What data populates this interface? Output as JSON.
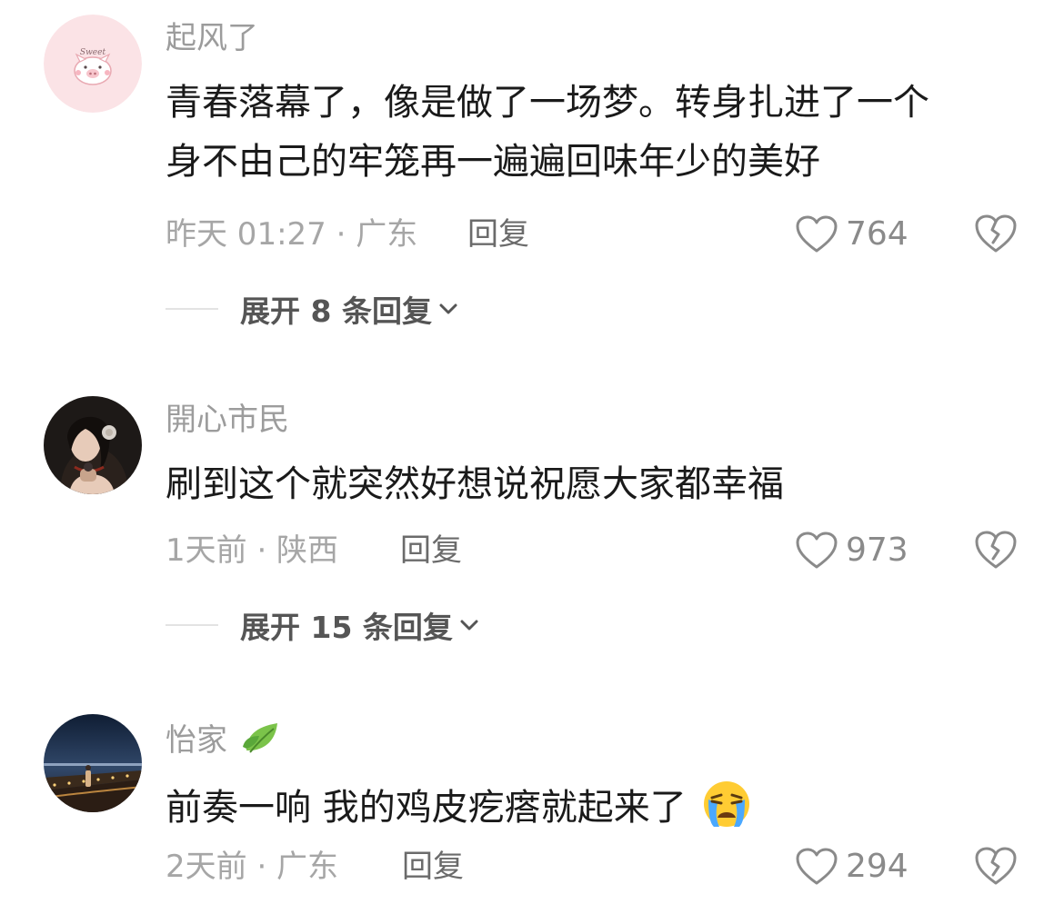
{
  "comments": [
    {
      "username": "起风了",
      "avatar_icon": "pig-sweet-avatar",
      "text_lines": [
        "青春落幕了，像是做了一场梦。转身扎进了一个",
        "身不由己的牢笼再一遍遍回味年少的美好"
      ],
      "meta": "昨天 01:27 · 广东",
      "reply_label": "回复",
      "likes": "764",
      "expand_label": "展开 8 条回复"
    },
    {
      "username": "開心市民",
      "avatar_icon": "woman-portrait-avatar",
      "text_lines": [
        "刷到这个就突然好想说祝愿大家都幸福"
      ],
      "meta": "1天前 · 陕西",
      "reply_label": "回复",
      "likes": "973",
      "expand_label": "展开 15 条回复"
    },
    {
      "username": "怡家",
      "username_badge_icon": "leaf-icon",
      "avatar_icon": "night-bridge-avatar",
      "text_lines": [
        "前奏一响 我的鸡皮疙瘩就起来了"
      ],
      "text_emoji_icon": "crying-face-emoji",
      "meta": "2天前 · 广东",
      "reply_label": "回复",
      "likes": "294"
    }
  ],
  "colors": {
    "username": "#9c9c9c",
    "text": "#1a1a1a",
    "meta": "#a6a6a6",
    "reply": "#6b6b6b",
    "expand": "#555555",
    "icon": "#8a8a8a"
  }
}
